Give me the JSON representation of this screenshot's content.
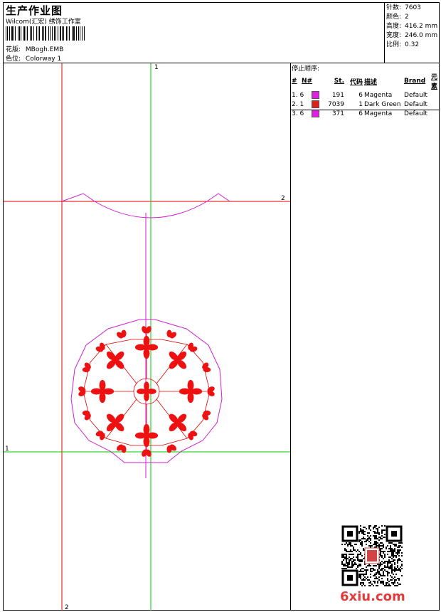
{
  "header": {
    "title": "生产作业图",
    "subtitle": "Wilcom(汇宏) 绣饰工作室",
    "design_label": "花版:",
    "design_value": "MBogh.EMB",
    "colorway_label": "色位:",
    "colorway_value": "Colorway 1"
  },
  "stats": [
    {
      "label": "针数:",
      "value": "7603"
    },
    {
      "label": "颜色:",
      "value": "2"
    },
    {
      "label": "高度:",
      "value": "416.2 mm"
    },
    {
      "label": "宽度:",
      "value": "246.0 mm"
    },
    {
      "label": "比例:",
      "value": "0.32"
    }
  ],
  "stop_sequence": {
    "title": "停止顺序:",
    "columns": [
      "#",
      "N#",
      "St.",
      "代码",
      "描述",
      "Brand",
      "元素"
    ],
    "rows": [
      {
        "idx": "1. 6",
        "color": "#e020e0",
        "st": "191",
        "code": "6",
        "desc": "Magenta",
        "brand": "Default"
      },
      {
        "idx": "2. 1",
        "color": "#e0201e",
        "st": "7039",
        "code": "1",
        "desc": "Dark Green",
        "brand": "Default"
      },
      {
        "idx": "3. 6",
        "color": "#e020e0",
        "st": "371",
        "code": "6",
        "desc": "Magenta",
        "brand": "Default"
      }
    ]
  },
  "axes": {
    "top_label": "1",
    "right_label": "2",
    "left_label": "1",
    "bottom_label": "2"
  },
  "colors": {
    "guide_red": "#e00000",
    "guide_green": "#00cc00",
    "magenta": "#d020d0",
    "motif_red": "#ee1111"
  },
  "watermark": {
    "text": "6xiu.com"
  }
}
